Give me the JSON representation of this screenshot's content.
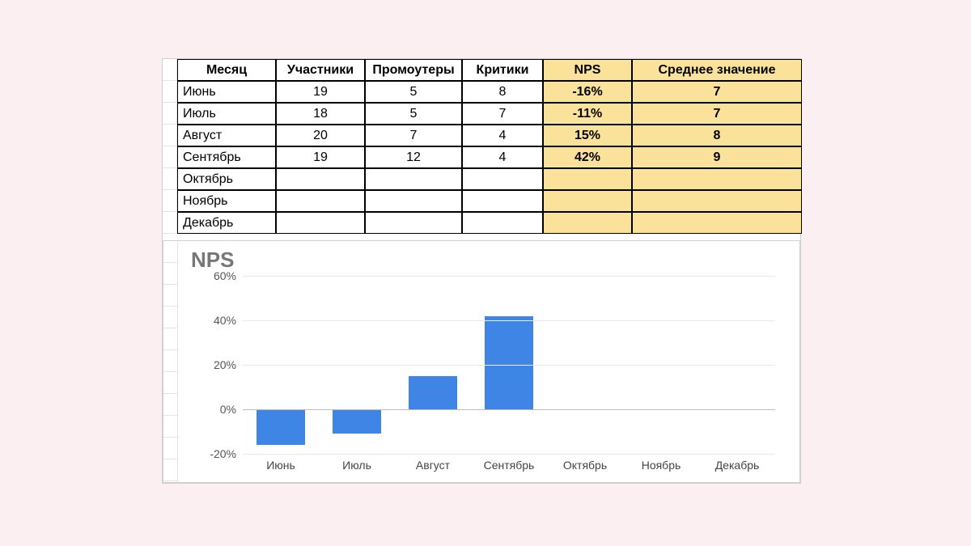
{
  "table": {
    "headers": [
      "Месяц",
      "Участники",
      "Промоутеры",
      "Критики",
      "NPS",
      "Среднее значение"
    ],
    "rows": [
      {
        "month": "Июнь",
        "participants": "19",
        "promoters": "5",
        "critics": "8",
        "nps": "-16%",
        "avg": "7"
      },
      {
        "month": "Июль",
        "participants": "18",
        "promoters": "5",
        "critics": "7",
        "nps": "-11%",
        "avg": "7"
      },
      {
        "month": "Август",
        "participants": "20",
        "promoters": "7",
        "critics": "4",
        "nps": "15%",
        "avg": "8"
      },
      {
        "month": "Сентябрь",
        "participants": "19",
        "promoters": "12",
        "critics": "4",
        "nps": "42%",
        "avg": "9"
      },
      {
        "month": "Октябрь",
        "participants": "",
        "promoters": "",
        "critics": "",
        "nps": "",
        "avg": ""
      },
      {
        "month": "Ноябрь",
        "participants": "",
        "promoters": "",
        "critics": "",
        "nps": "",
        "avg": ""
      },
      {
        "month": "Декабрь",
        "participants": "",
        "promoters": "",
        "critics": "",
        "nps": "",
        "avg": ""
      }
    ]
  },
  "chart_data": {
    "type": "bar",
    "title": "NPS",
    "categories": [
      "Июнь",
      "Июль",
      "Август",
      "Сентябрь",
      "Октябрь",
      "Ноябрь",
      "Декабрь"
    ],
    "values": [
      -16,
      -11,
      15,
      42,
      null,
      null,
      null
    ],
    "ylim": [
      -20,
      60
    ],
    "yticks": [
      -20,
      0,
      20,
      40,
      60
    ],
    "ytick_labels": [
      "-20%",
      "0%",
      "20%",
      "40%",
      "60%"
    ],
    "xlabel": "",
    "ylabel": ""
  }
}
